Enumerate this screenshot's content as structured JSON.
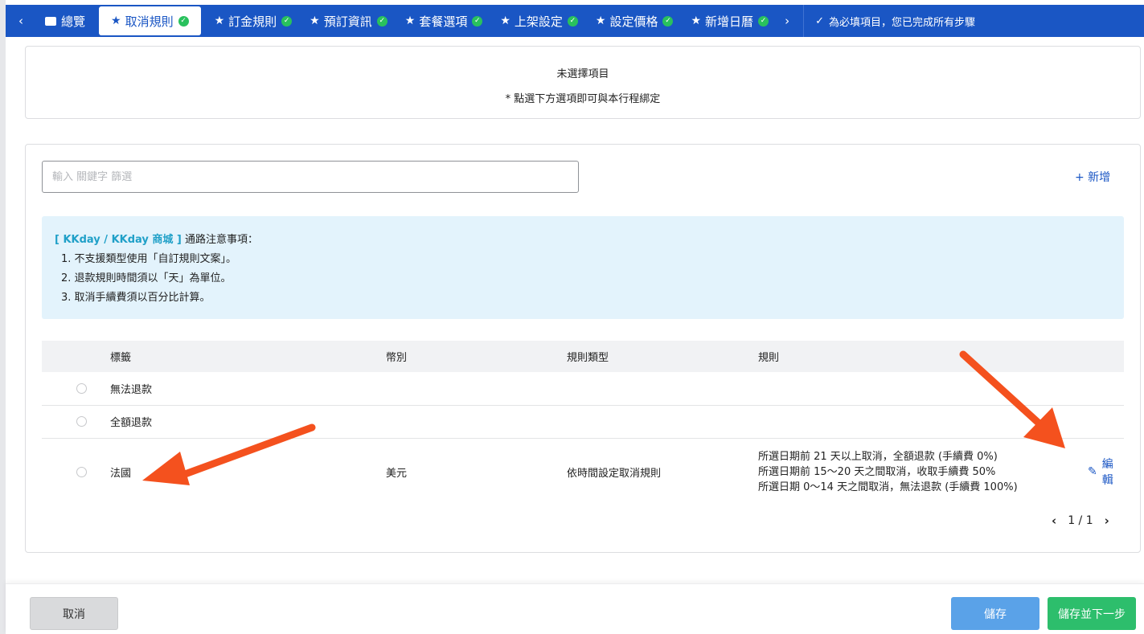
{
  "nav": {
    "prev": "‹",
    "next": "›",
    "tabs": [
      {
        "label": "總覽"
      },
      {
        "label": "取消規則"
      },
      {
        "label": "訂金規則"
      },
      {
        "label": "預訂資訊"
      },
      {
        "label": "套餐選項"
      },
      {
        "label": "上架設定"
      },
      {
        "label": "設定價格"
      },
      {
        "label": "新增日曆"
      }
    ],
    "note": "為必填項目，您已完成所有步驟"
  },
  "selection": {
    "title": "未選擇項目",
    "hint": "* 點選下方選項即可與本行程綁定"
  },
  "search": {
    "placeholder": "輸入 關鍵字 篩選"
  },
  "add_label": "+ 新增",
  "notice": {
    "tag": "[ KKday / KKday 商城 ]",
    "title": " 通路注意事項：",
    "items": [
      "1. 不支援類型使用「自訂規則文案」。",
      "2. 退款規則時間須以「天」為單位。",
      "3. 取消手續費須以百分比計算。"
    ]
  },
  "table": {
    "headers": {
      "tag": "標籤",
      "currency": "幣別",
      "type": "規則類型",
      "rule": "規則"
    },
    "rows": [
      {
        "tag": "無法退款",
        "currency": "",
        "type": "",
        "rules": []
      },
      {
        "tag": "全額退款",
        "currency": "",
        "type": "",
        "rules": []
      },
      {
        "tag": "法國",
        "currency": "美元",
        "type": "依時間設定取消規則",
        "rules": [
          "所選日期前 21 天以上取消，全額退款 (手續費 0%)",
          "所選日期前 15～20 天之間取消，收取手續費 50%",
          "所選日期 0～14 天之間取消，無法退款 (手續費 100%)"
        ],
        "edit_label": "編輯"
      }
    ]
  },
  "pager": {
    "prev": "‹",
    "text": "1 / 1",
    "next": "›"
  },
  "footer": {
    "cancel": "取消",
    "save": "儲存",
    "save_next": "儲存並下一步"
  },
  "colors": {
    "nav_bg": "#1a56c4",
    "check": "#29c15d",
    "notice_bg": "#e3f3fc",
    "notice_tag": "#20a0c8",
    "arrow": "#f4511e",
    "save": "#5aa2e8",
    "save_next": "#2dbe6c"
  }
}
